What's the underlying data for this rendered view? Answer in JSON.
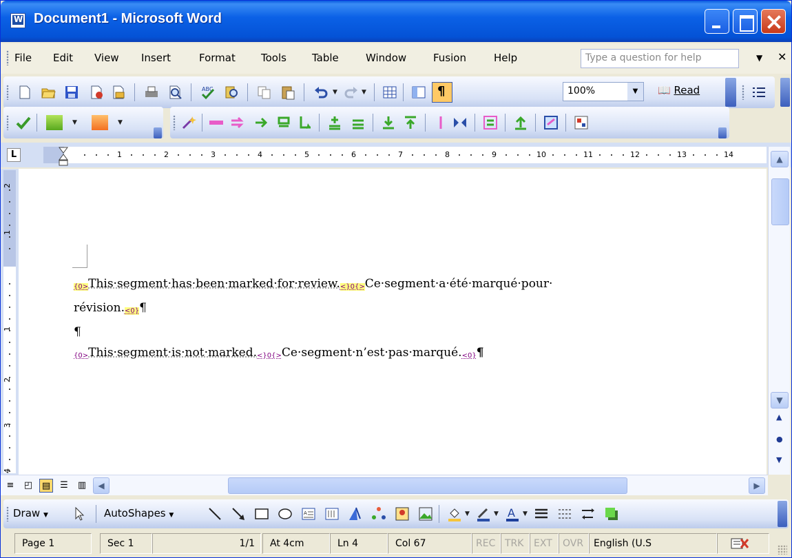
{
  "window": {
    "title": "Document1 - Microsoft Word"
  },
  "menu": {
    "items": [
      "File",
      "Edit",
      "View",
      "Insert",
      "Format",
      "Tools",
      "Table",
      "Window",
      "Fusion",
      "Help"
    ],
    "help_placeholder": "Type a question for help"
  },
  "toolbar": {
    "zoom": "100%",
    "read_label": "Read"
  },
  "ruler": {
    "numbers": [
      "1",
      "2",
      "3",
      "4",
      "5",
      "6",
      "7",
      "8",
      "9",
      "10",
      "11",
      "12",
      "13",
      "14"
    ],
    "vnumbers": [
      "2",
      "1",
      "1",
      "2",
      "3",
      "4"
    ]
  },
  "document": {
    "p1_tag_open": "{0>",
    "p1_source": "This·segment·has·been·marked·for·review.",
    "p1_tag_mid": "<}0{>",
    "p1_target_a": "Ce·segment·a·été·marqué·pour·",
    "p1_target_b": "révision.",
    "p1_tag_close": "<0}",
    "pilcrow": "¶",
    "p3_tag_open": "{0>",
    "p3_source": "This·segment·is·not·marked.",
    "p3_tag_mid": "<}0{>",
    "p3_target": "Ce·segment·n’est·pas·marqué.",
    "p3_tag_close": "<0}"
  },
  "drawing": {
    "draw_label": "Draw",
    "autoshapes_label": "AutoShapes"
  },
  "status": {
    "page": "Page 1",
    "sec": "Sec 1",
    "pages": "1/1",
    "at": "At 4cm",
    "ln": "Ln 4",
    "col": "Col 67",
    "rec": "REC",
    "trk": "TRK",
    "ext": "EXT",
    "ovr": "OVR",
    "language": "English (U.S"
  },
  "colors": {
    "title_blue": "#0b61e6",
    "highlight": "#ffff80",
    "tag_purple": "#800080"
  }
}
